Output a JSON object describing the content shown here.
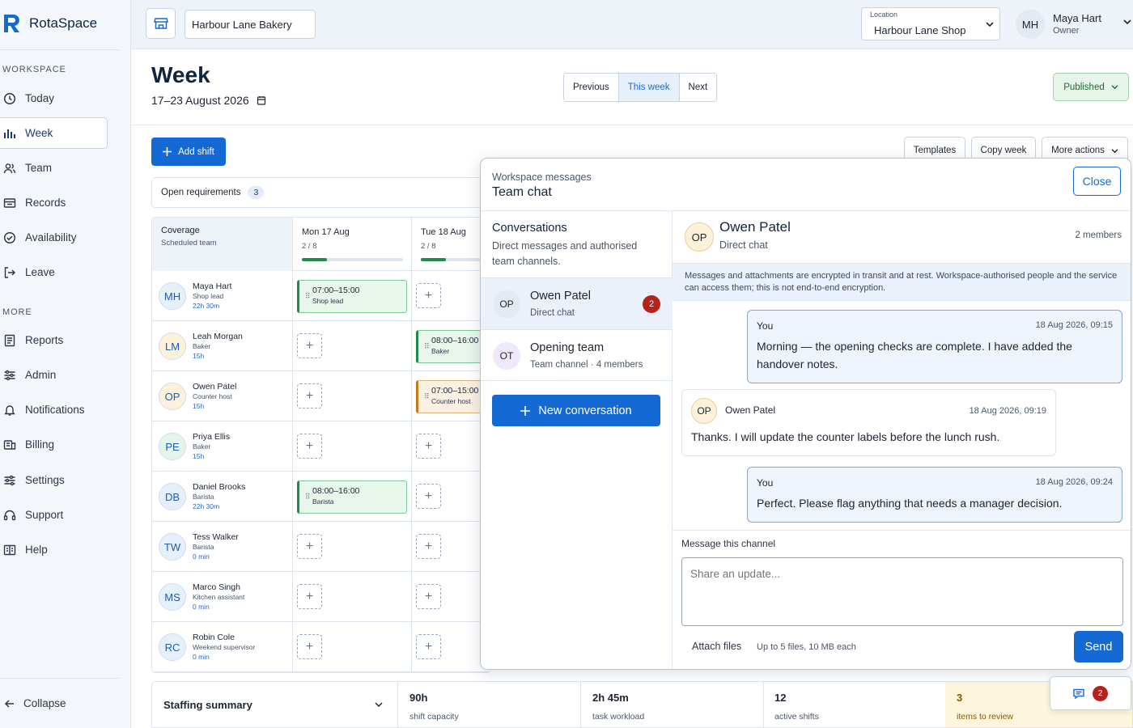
{
  "app": {
    "name": "RotaSpace"
  },
  "sidebar": {
    "workspace_label": "WORKSPACE",
    "more_label": "MORE",
    "workspace_items": [
      {
        "label": "Today",
        "icon": "clock-icon"
      },
      {
        "label": "Week",
        "icon": "bar-chart-icon",
        "active": true
      },
      {
        "label": "Team",
        "icon": "users-icon"
      },
      {
        "label": "Records",
        "icon": "folder-icon"
      },
      {
        "label": "Availability",
        "icon": "check-circle-icon"
      },
      {
        "label": "Leave",
        "icon": "logout-icon"
      }
    ],
    "more_items": [
      {
        "label": "Reports",
        "icon": "report-icon"
      },
      {
        "label": "Admin",
        "icon": "sliders-icon"
      },
      {
        "label": "Notifications",
        "icon": "bell-icon"
      },
      {
        "label": "Billing",
        "icon": "billing-icon"
      },
      {
        "label": "Settings",
        "icon": "sliders-icon"
      },
      {
        "label": "Support",
        "icon": "headset-icon"
      },
      {
        "label": "Help",
        "icon": "book-icon"
      }
    ],
    "collapse_label": "Collapse"
  },
  "topbar": {
    "workspace_name": "Harbour Lane Bakery",
    "location_label": "Location",
    "location_value": "Harbour Lane Shop",
    "user": {
      "initials": "MH",
      "name": "Maya Hart",
      "role": "Owner"
    }
  },
  "page": {
    "title": "Week",
    "date_range": "17–23 August 2026",
    "nav": {
      "previous": "Previous",
      "this_week": "This week",
      "next": "Next"
    },
    "status": "Published",
    "add_shift": "Add shift",
    "templates": "Templates",
    "copy_week": "Copy week",
    "more_actions": "More actions",
    "open_requirements": {
      "label": "Open requirements",
      "count": "3"
    }
  },
  "grid": {
    "coverage_title": "Coverage",
    "coverage_sub": "Scheduled team",
    "days": [
      {
        "label": "Mon 17 Aug",
        "ratio": "2 / 8",
        "fill": 0.25
      },
      {
        "label": "Tue 18 Aug",
        "ratio": "2 / 8",
        "fill": 0.25
      }
    ],
    "people": [
      {
        "initials": "MH",
        "name": "Maya Hart",
        "role": "Shop lead",
        "hours": "22h 30m",
        "color": "#e6f0fb",
        "mon": {
          "time": "07:00–15:00",
          "role": "Shop lead",
          "tone": "green"
        },
        "tue": null
      },
      {
        "initials": "LM",
        "name": "Leah Morgan",
        "role": "Baker",
        "hours": "15h",
        "color": "#fdf2d9",
        "mon": null,
        "tue": {
          "time": "08:00–16:00",
          "role": "Baker",
          "tone": "green"
        }
      },
      {
        "initials": "OP",
        "name": "Owen Patel",
        "role": "Counter host",
        "hours": "15h",
        "color": "#fdf2d9",
        "mon": null,
        "tue": {
          "time": "07:00–15:00",
          "role": "Counter host",
          "tone": "orange"
        }
      },
      {
        "initials": "PE",
        "name": "Priya Ellis",
        "role": "Baker",
        "hours": "15h",
        "color": "#e5f5ea",
        "mon": null,
        "tue": null
      },
      {
        "initials": "DB",
        "name": "Daniel Brooks",
        "role": "Barista",
        "hours": "22h 30m",
        "color": "#e6f0fb",
        "mon": {
          "time": "08:00–16:00",
          "role": "Barista",
          "tone": "green"
        },
        "tue": null
      },
      {
        "initials": "TW",
        "name": "Tess Walker",
        "role": "Barista",
        "hours": "0 min",
        "color": "#e6f0fb",
        "mon": null,
        "tue": null
      },
      {
        "initials": "MS",
        "name": "Marco Singh",
        "role": "Kitchen assistant",
        "hours": "0 min",
        "color": "#e6f0fb",
        "mon": null,
        "tue": null
      },
      {
        "initials": "RC",
        "name": "Robin Cole",
        "role": "Weekend supervisor",
        "hours": "0 min",
        "color": "#e6f0fb",
        "mon": null,
        "tue": null
      }
    ]
  },
  "summary": {
    "title": "Staffing summary",
    "stats": [
      {
        "value": "90h",
        "label": "shift capacity"
      },
      {
        "value": "2h 45m",
        "label": "task workload"
      },
      {
        "value": "12",
        "label": "active shifts"
      },
      {
        "value": "3",
        "label": "items to review"
      }
    ]
  },
  "chat": {
    "kicker": "Workspace messages",
    "title": "Team chat",
    "close": "Close",
    "conversations_title": "Conversations",
    "conversations_desc": "Direct messages and authorised team channels.",
    "conversations": [
      {
        "initials": "OP",
        "name": "Owen Patel",
        "sub": "Direct chat",
        "unread": "2"
      },
      {
        "initials": "OT",
        "name": "Opening team",
        "sub": "Team channel · 4 members"
      }
    ],
    "new_conversation": "New conversation",
    "thread": {
      "initials": "OP",
      "name": "Owen Patel",
      "sub": "Direct chat",
      "members": "2 members",
      "notice": "Messages and attachments are encrypted in transit and at rest. Workspace-authorised people and the service can access them; this is not end-to-end encryption.",
      "messages": [
        {
          "author": "You",
          "time": "18 Aug 2026, 09:15",
          "text": "Morning — the opening checks are complete. I have added the handover notes."
        },
        {
          "author": "Owen Patel",
          "initials": "OP",
          "time": "18 Aug 2026, 09:19",
          "text": "Thanks. I will update the counter labels before the lunch rush."
        },
        {
          "author": "You",
          "time": "18 Aug 2026, 09:24",
          "text": "Perfect. Please flag anything that needs a manager decision."
        }
      ]
    },
    "composer": {
      "label": "Message this channel",
      "placeholder": "Share an update...",
      "attach": "Attach files",
      "attach_hint": "Up to 5 files, 10 MB each",
      "send": "Send"
    },
    "fab_badge": "2"
  }
}
